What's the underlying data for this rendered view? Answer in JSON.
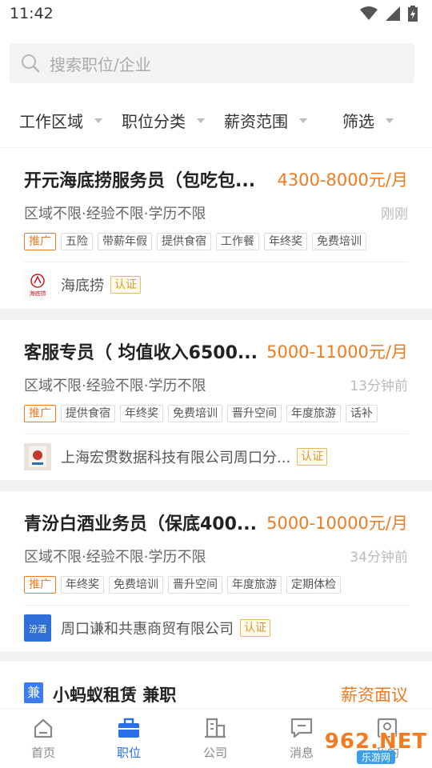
{
  "status_bar": {
    "time": "11:42"
  },
  "search": {
    "placeholder": "搜索职位/企业"
  },
  "filters": [
    {
      "label": "工作区域"
    },
    {
      "label": "职位分类"
    },
    {
      "label": "薪资范围"
    },
    {
      "label": "筛选"
    }
  ],
  "jobs": [
    {
      "title": "开元海底捞服务员（包吃包...",
      "salary": "4300-8000元/月",
      "meta": "区域不限·经验不限·学历不限",
      "time": "刚刚",
      "tags": [
        "推广",
        "五险",
        "带薪年假",
        "提供食宿",
        "工作餐",
        "年终奖",
        "免费培训"
      ],
      "company": "海底捞",
      "cert": "认证",
      "logo_text": "海底捞"
    },
    {
      "title": "客服专员（ 均值收入6500...",
      "salary": "5000-11000元/月",
      "meta": "区域不限·经验不限·学历不限",
      "time": "13分钟前",
      "tags": [
        "推广",
        "提供食宿",
        "年终奖",
        "免费培训",
        "晋升空间",
        "年度旅游",
        "话补"
      ],
      "company": "上海宏贯数据科技有限公司周口分...",
      "cert": "认证",
      "logo_text": ""
    },
    {
      "title": "青汾白酒业务员（保底400...",
      "salary": "5000-10000元/月",
      "meta": "区域不限·经验不限·学历不限",
      "time": "34分钟前",
      "tags": [
        "推广",
        "年终奖",
        "免费培训",
        "晋升空间",
        "年度旅游",
        "定期体检"
      ],
      "company": "周口谦和共惠商贸有限公司",
      "cert": "认证",
      "logo_text": "汾酒"
    }
  ],
  "partial_job": {
    "badge": "兼",
    "title": "小蚂蚁租赁 兼职",
    "salary": "薪资面议"
  },
  "tabs": [
    {
      "label": "首页",
      "icon": "home-icon"
    },
    {
      "label": "职位",
      "icon": "briefcase-icon",
      "active": true
    },
    {
      "label": "公司",
      "icon": "building-icon"
    },
    {
      "label": "消息",
      "icon": "message-icon"
    },
    {
      "label": "我的",
      "icon": "profile-icon"
    }
  ],
  "watermark": {
    "big": "962.NET",
    "small": "乐游网"
  },
  "colors": {
    "accent": "#2a6ee8",
    "salary": "#f07a20",
    "cert": "#d99a2b"
  }
}
